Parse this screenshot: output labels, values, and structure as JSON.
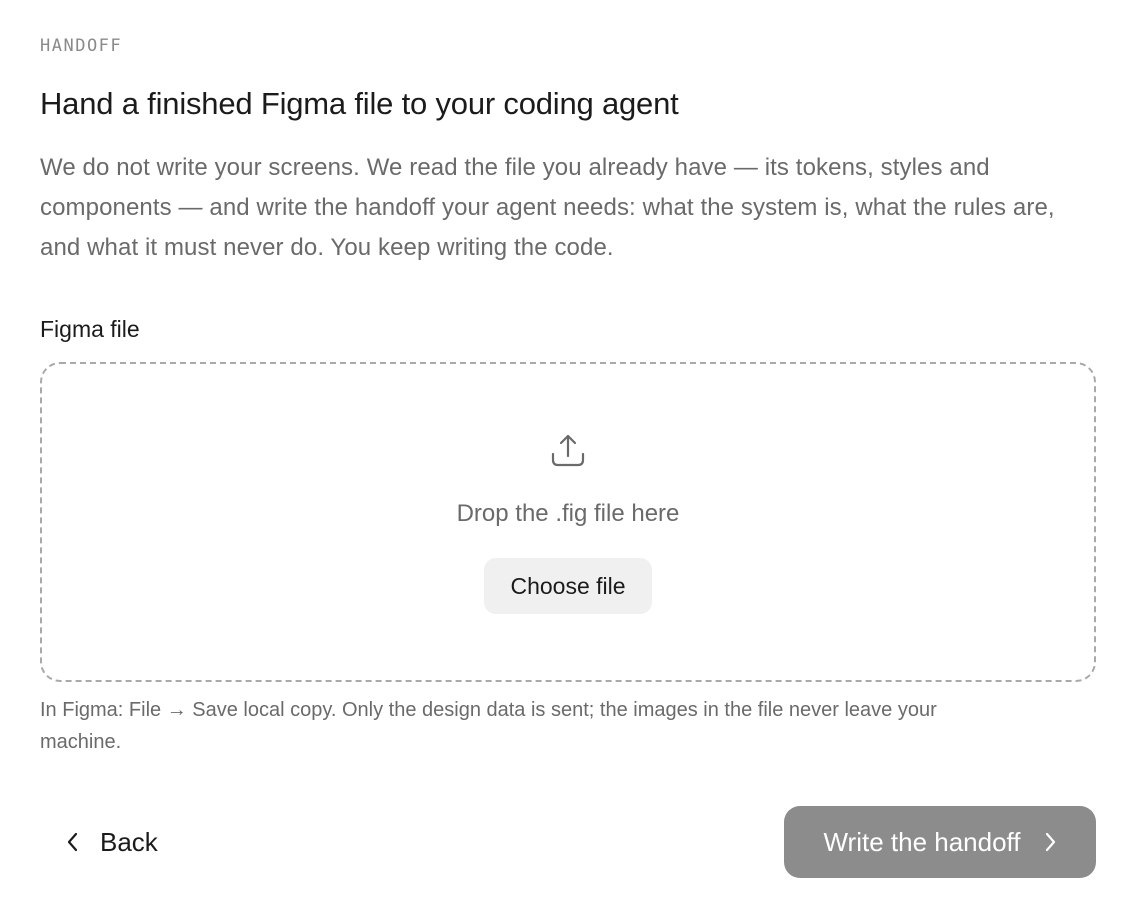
{
  "header": {
    "eyebrow": "HANDOFF",
    "title": "Hand a finished Figma file to your coding agent",
    "intro": "We do not write your screens. We read the file you already have — its tokens, styles and components — and write the handoff your agent needs: what the system is, what the rules are, and what it must never do. You keep writing the code."
  },
  "upload": {
    "label": "Figma file",
    "drop_text": "Drop the .fig file here",
    "choose_label": "Choose file",
    "icon": "upload-icon",
    "hint": "In Figma: File → Save local copy. Only the design data is sent; the images in the file never leave your machine."
  },
  "footer": {
    "back_label": "Back",
    "back_icon": "chevron-left-icon",
    "primary_label": "Write the handoff",
    "primary_icon": "chevron-right-icon",
    "primary_color": "#8c8c8c"
  }
}
